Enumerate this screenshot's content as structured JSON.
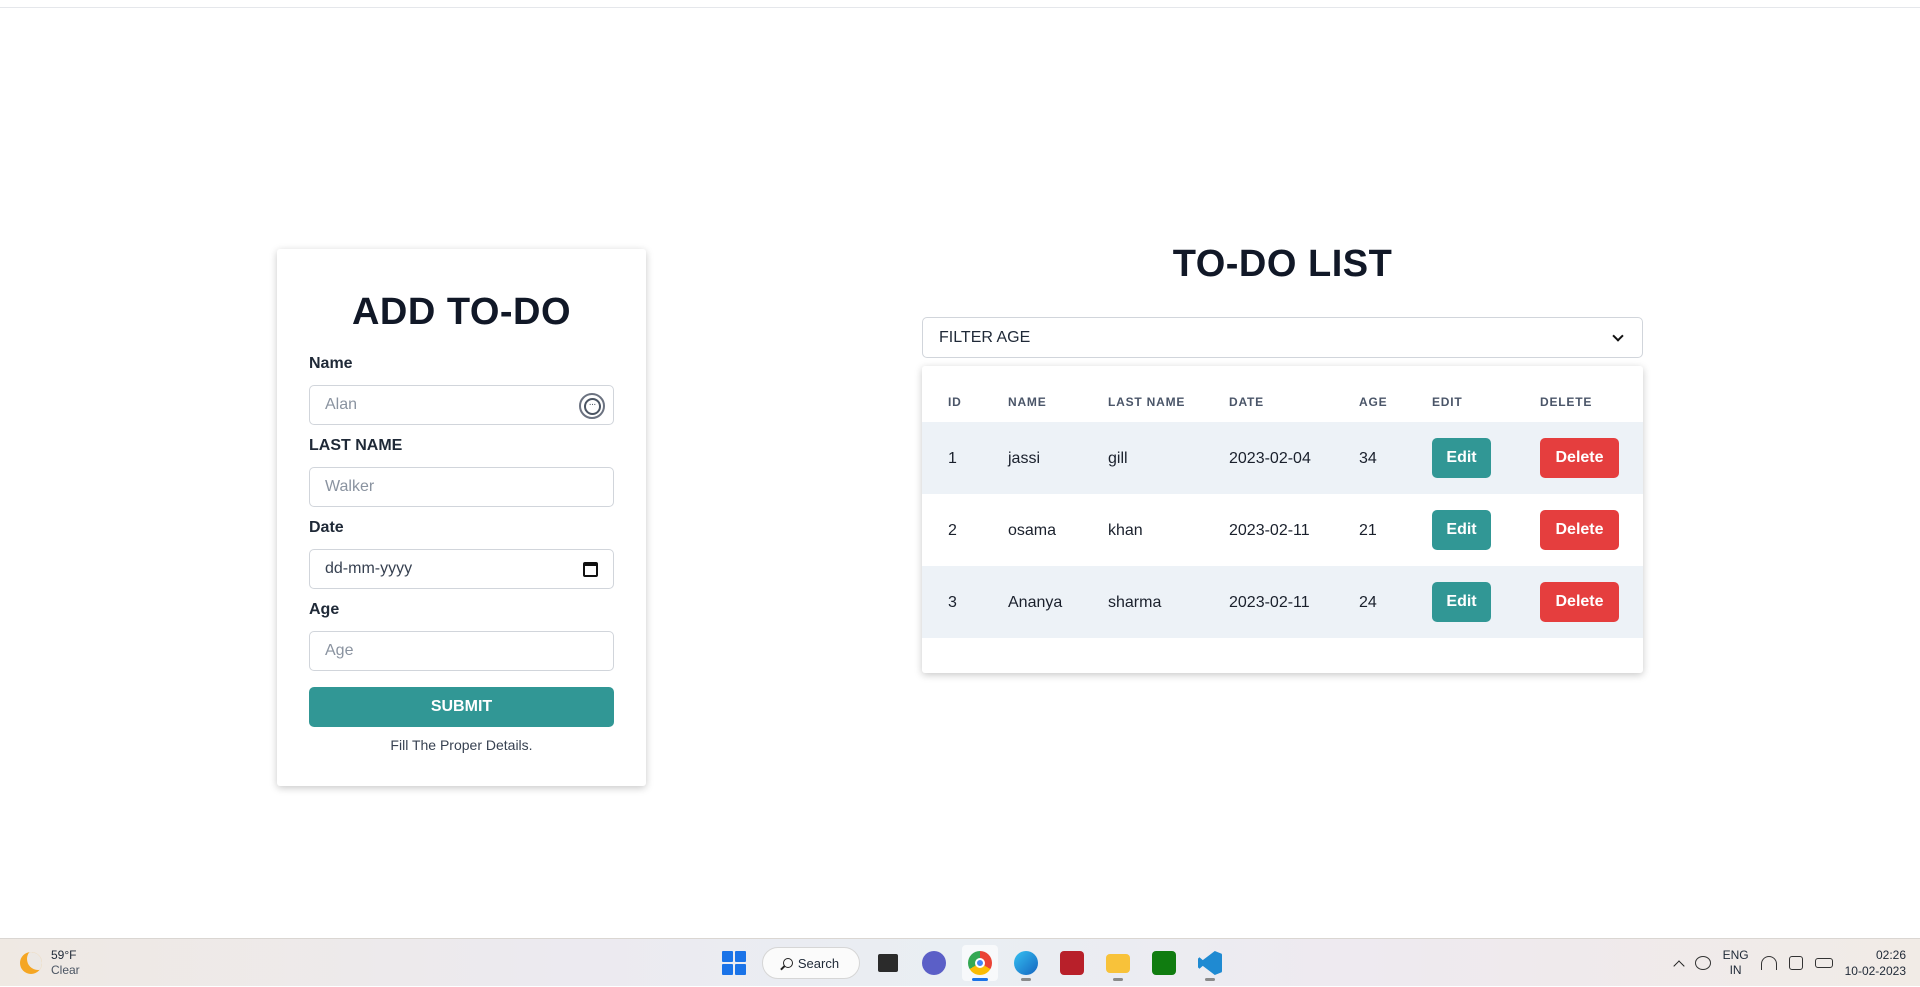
{
  "form": {
    "title": "ADD TO-DO",
    "name_label": "Name",
    "name_placeholder": "Alan",
    "last_name_label": "LAST NAME",
    "last_name_placeholder": "Walker",
    "date_label": "Date",
    "date_placeholder": "dd-mm-yyyy",
    "age_label": "Age",
    "age_placeholder": "Age",
    "submit_label": "SUBMIT",
    "helper_text": "Fill The Proper Details."
  },
  "list": {
    "title": "TO-DO LIST",
    "filter_label": "FILTER AGE",
    "columns": [
      "ID",
      "NAME",
      "LAST NAME",
      "DATE",
      "AGE",
      "EDIT",
      "DELETE"
    ],
    "edit_label": "Edit",
    "delete_label": "Delete",
    "rows": [
      {
        "id": "1",
        "name": "jassi",
        "last_name": "gill",
        "date": "2023-02-04",
        "age": "34"
      },
      {
        "id": "2",
        "name": "osama",
        "last_name": "khan",
        "date": "2023-02-11",
        "age": "21"
      },
      {
        "id": "3",
        "name": "Ananya",
        "last_name": "sharma",
        "date": "2023-02-11",
        "age": "24"
      }
    ]
  },
  "colors": {
    "teal": "#319795",
    "red": "#e53e3e",
    "stripe": "#edf2f7"
  },
  "taskbar": {
    "weather_temp": "59°F",
    "weather_condition": "Clear",
    "search_label": "Search",
    "language_top": "ENG",
    "language_bottom": "IN",
    "time": "02:26",
    "date": "10-02-2023",
    "apps": [
      "task-view-icon",
      "teams-icon",
      "chrome-icon",
      "edge-icon",
      "app-red-icon",
      "file-explorer-icon",
      "xbox-icon",
      "vscode-icon"
    ]
  }
}
